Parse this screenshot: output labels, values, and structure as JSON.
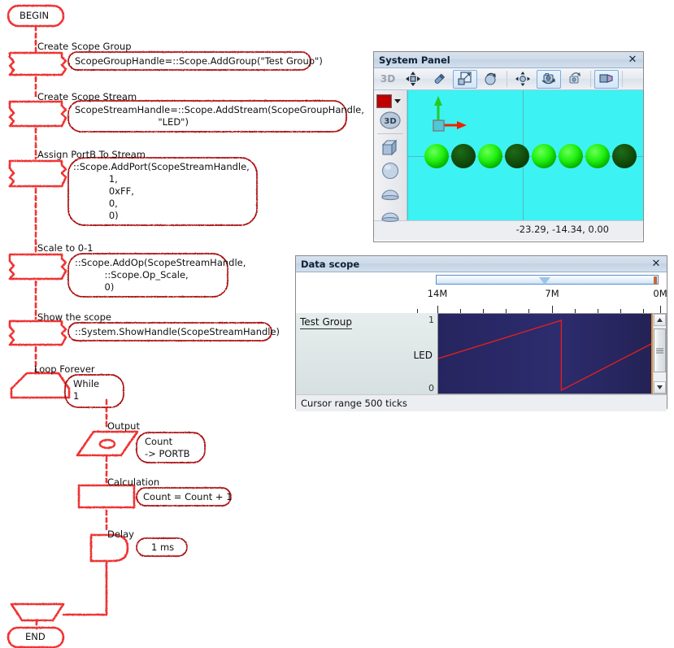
{
  "flowchart": {
    "begin_label": "BEGIN",
    "end_label": "END",
    "steps": [
      {
        "caption": "Create Scope Group",
        "code": "ScopeGroupHandle=::Scope.AddGroup(\"Test Group\")"
      },
      {
        "caption": "Create Scope Stream",
        "code": "ScopeStreamHandle=::Scope.AddStream(ScopeGroupHandle,\n                            \"LED\")"
      },
      {
        "caption": "Assign PortB To Stream",
        "code": "::Scope.AddPort(ScopeStreamHandle,\n            1,\n            0xFF,\n            0,\n            0)"
      },
      {
        "caption": "Scale to 0-1",
        "code": "::Scope.AddOp(ScopeStreamHandle,\n          ::Scope.Op_Scale,\n          0)"
      },
      {
        "caption": "Show the scope",
        "code": "::System.ShowHandle(ScopeStreamHandle)"
      },
      {
        "caption": "Loop Forever",
        "code": "While\n1"
      },
      {
        "caption": "Output",
        "code": "Count\n-> PORTB"
      },
      {
        "caption": "Calculation",
        "code": "Count = Count + 1"
      },
      {
        "caption": "Delay",
        "code": "1 ms"
      }
    ],
    "stroke_color": "#ee3333",
    "callout_color": "#aa1111"
  },
  "system_panel": {
    "title": "System Panel",
    "close_label": "✕",
    "mode_label": "3D",
    "status_text": "-23.29, -14.34, 0.00",
    "toolbar": [
      {
        "name": "translate-tool",
        "active": false
      },
      {
        "name": "pencil-tool",
        "active": false
      },
      {
        "name": "scale-tool",
        "active": true
      },
      {
        "name": "rotate-tool",
        "active": false
      },
      {
        "name": "move-pivot-tool",
        "active": false
      },
      {
        "name": "camera-orbit-tool",
        "active": true
      },
      {
        "name": "camera-roll-tool",
        "active": false
      },
      {
        "name": "perspective-tool",
        "active": true
      }
    ],
    "sidebar": [
      {
        "name": "color-swatch",
        "color": "#c00000"
      },
      {
        "name": "3d-mode-button"
      },
      {
        "name": "cube-shape"
      },
      {
        "name": "sphere-shape"
      },
      {
        "name": "dome-shape"
      },
      {
        "name": "disc-shape"
      }
    ],
    "viewport": {
      "background": "#3df2f2",
      "axis_x_color": "#ee2200",
      "axis_y_color": "#22cc22",
      "leds": [
        "on",
        "off",
        "on",
        "off",
        "on",
        "on",
        "on",
        "off"
      ]
    }
  },
  "data_scope": {
    "title": "Data scope",
    "close_label": "✕",
    "group_label": "Test Group",
    "stream_label": "LED",
    "y_max_label": "1",
    "y_min_label": "0",
    "status_text": "Cursor range 500 ticks",
    "tick_labels": [
      "14M",
      "7M",
      "0M"
    ],
    "plot_background": "#2a2a66",
    "trace_color": "#e02020"
  },
  "chart_data": {
    "type": "line",
    "title": "Data scope",
    "xlabel": "",
    "ylabel": "LED",
    "series": [
      {
        "name": "LED",
        "x": [
          0.0,
          0.575,
          0.578,
          1.0
        ],
        "y": [
          0.45,
          1.0,
          0.0,
          0.65
        ]
      }
    ],
    "xlim": [
      16000000,
      0
    ],
    "ylim": [
      0,
      1
    ],
    "xticks": [
      14000000,
      7000000,
      0
    ],
    "xticklabels": [
      "14M",
      "7M",
      "0M"
    ],
    "yticks": [
      0,
      1
    ],
    "yticklabels": [
      "0",
      "1"
    ],
    "grid": false,
    "legend": "none",
    "annotations": [
      "Test Group",
      "Cursor range 500 ticks"
    ]
  }
}
